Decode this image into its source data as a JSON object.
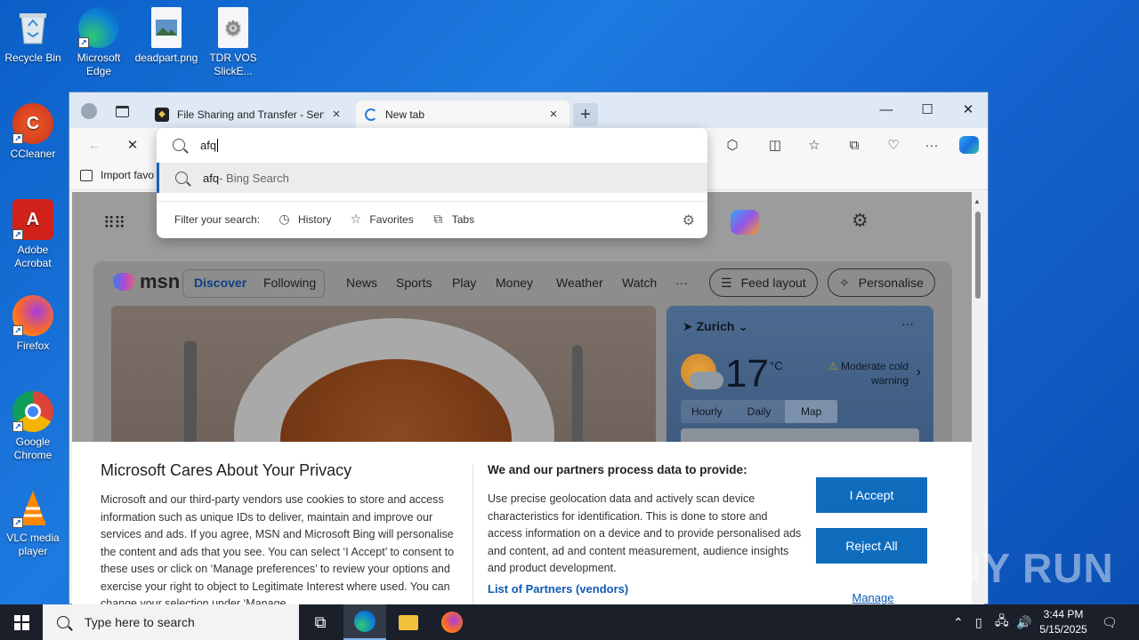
{
  "desktop": {
    "icons": [
      {
        "label": "Recycle Bin"
      },
      {
        "label": "Microsoft Edge"
      },
      {
        "label": "deadpart.png"
      },
      {
        "label": "TDR VOS SlickE..."
      },
      {
        "label": "CCleaner"
      },
      {
        "label": "Adobe Acrobat"
      },
      {
        "label": "Firefox"
      },
      {
        "label": "Google Chrome"
      },
      {
        "label": "VLC media player"
      }
    ]
  },
  "browser": {
    "tabs": [
      {
        "label": "File Sharing and Transfer - Send L",
        "active": false
      },
      {
        "label": "New tab",
        "active": true
      }
    ],
    "new_tab_symbol": "+",
    "favorites_bar": {
      "import_label": "Import favo"
    },
    "address": {
      "typed": "afq",
      "suggestion_query": "afq",
      "suggestion_suffix": " - Bing Search",
      "filter_label": "Filter your search:",
      "filters": [
        "History",
        "Favorites",
        "Tabs"
      ]
    }
  },
  "msn": {
    "logo": "msn",
    "nav": [
      "Discover",
      "Following",
      "News",
      "Sports",
      "Play",
      "Money",
      "Weather",
      "Watch",
      "···"
    ],
    "selected_nav": "Discover",
    "buttons": {
      "feed_layout": "Feed layout",
      "personalise": "Personalise"
    },
    "weather": {
      "city": "Zurich",
      "temperature": "17",
      "unit": "°C",
      "warning": "Moderate cold warning",
      "tabs": [
        "Hourly",
        "Daily",
        "Map"
      ],
      "selected_tab": "Map",
      "more": "···"
    }
  },
  "privacy": {
    "title": "Microsoft Cares About Your Privacy",
    "body": "Microsoft and our third-party vendors use cookies to store and access information such as unique IDs to deliver, maintain and improve our services and ads. If you agree, MSN and Microsoft Bing will personalise the content and ads that you see. You can select ‘I Accept’ to consent to these uses or click on ‘Manage preferences’ to review your options and exercise your right to object to Legitimate Interest where used.  You can change your selection under ‘Manage",
    "right_title": "We and our partners process data to provide:",
    "right_body": "Use precise geolocation data and actively scan device characteristics for identification. This is done to store and access information on a device and to provide personalised ads and content, ad and content measurement, audience insights and product development.",
    "partners_link": "List of Partners (vendors)",
    "accept": "I Accept",
    "reject": "Reject All",
    "manage": "Manage Preferences"
  },
  "watermark": "ANY RUN",
  "taskbar": {
    "search_placeholder": "Type here to search",
    "time": "3:44 PM",
    "date": "5/15/2025"
  },
  "colors": {
    "accent": "#0f6cbd",
    "desktop": "#1464cf",
    "link": "#0f5cb5"
  }
}
